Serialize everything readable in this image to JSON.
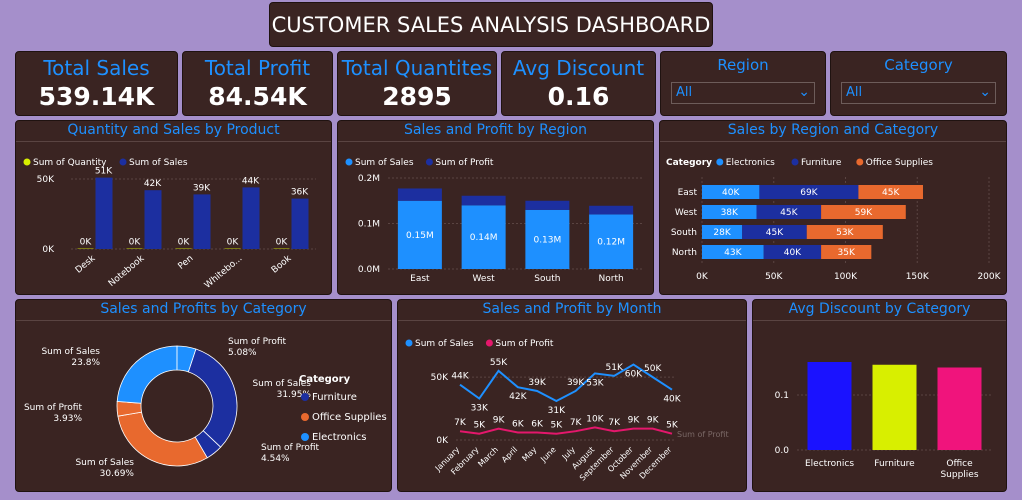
{
  "title": "CUSTOMER SALES ANALYSIS DASHBOARD",
  "kpis": [
    {
      "label": "Total Sales",
      "value": "539.14K"
    },
    {
      "label": "Total Profit",
      "value": "84.54K"
    },
    {
      "label": "Total Quantites",
      "value": "2895"
    },
    {
      "label": "Avg Discount",
      "value": "0.16"
    }
  ],
  "slicers": [
    {
      "label": "Region",
      "value": "All"
    },
    {
      "label": "Category",
      "value": "All"
    }
  ],
  "colors": {
    "blue": "#1e90ff",
    "navy": "#1c2fa0",
    "lime": "#d8ef00",
    "orange": "#e8692e",
    "pink": "#f0147c",
    "magenta": "#e4176c",
    "bg": "#3a2422"
  },
  "chart_data": [
    {
      "type": "bar",
      "title": "Quantity and Sales by Product",
      "categories": [
        "Desk",
        "Notebook",
        "Pen",
        "Whiteboard",
        "Book"
      ],
      "category_labels": [
        "Desk",
        "Notebook",
        "Pen",
        "Whitebo...",
        "Book"
      ],
      "series": [
        {
          "name": "Sum of Quantity",
          "values": [
            0.3,
            0.3,
            0.3,
            0.3,
            0.3
          ],
          "labels": [
            "0K",
            "0K",
            "0K",
            "0K",
            "0K"
          ]
        },
        {
          "name": "Sum of Sales",
          "values": [
            51,
            42,
            39,
            44,
            36
          ],
          "labels": [
            "51K",
            "42K",
            "39K",
            "44K",
            "36K"
          ]
        }
      ],
      "yticks": [
        "0K",
        "50K"
      ],
      "ylim": [
        0,
        60
      ]
    },
    {
      "type": "bar",
      "title": "Sales and Profit by Region",
      "categories": [
        "East",
        "West",
        "South",
        "North"
      ],
      "series": [
        {
          "name": "Sum of Sales",
          "values": [
            0.15,
            0.14,
            0.13,
            0.12
          ],
          "labels": [
            "0.15M",
            "0.14M",
            "0.13M",
            "0.12M"
          ]
        },
        {
          "name": "Sum of Profit",
          "values": [
            0.027,
            0.021,
            0.02,
            0.019
          ]
        }
      ],
      "stacked": true,
      "yticks": [
        "0.0M",
        "0.1M",
        "0.2M"
      ],
      "ylim": [
        0,
        0.2
      ]
    },
    {
      "type": "bar",
      "orientation": "horizontal",
      "title": "Sales by Region and Category",
      "legend_title": "Category",
      "categories": [
        "East",
        "West",
        "South",
        "North"
      ],
      "series": [
        {
          "name": "Electronics",
          "values": [
            40,
            38,
            28,
            43
          ],
          "labels": [
            "40K",
            "38K",
            "28K",
            "43K"
          ]
        },
        {
          "name": "Furniture",
          "values": [
            69,
            45,
            45,
            40
          ],
          "labels": [
            "69K",
            "45K",
            "45K",
            "40K"
          ]
        },
        {
          "name": "Office Supplies",
          "values": [
            45,
            59,
            53,
            35
          ],
          "labels": [
            "45K",
            "59K",
            "53K",
            "35K"
          ]
        }
      ],
      "stacked": true,
      "xticks": [
        "0K",
        "50K",
        "100K",
        "150K",
        "200K"
      ],
      "xlim": [
        0,
        200
      ]
    },
    {
      "type": "pie",
      "title": "Sales and Profits by Category",
      "legend_title": "Category",
      "legend": [
        "Furniture",
        "Office Supplies",
        "Electronics"
      ],
      "slices": [
        {
          "label": "Sum of Sales",
          "pct": "31.95%",
          "value": 31.95,
          "category": "Furniture"
        },
        {
          "label": "Sum of Profit",
          "pct": "4.54%",
          "value": 4.54,
          "category": "Furniture"
        },
        {
          "label": "Sum of Sales",
          "pct": "30.69%",
          "value": 30.69,
          "category": "Office Supplies"
        },
        {
          "label": "Sum of Profit",
          "pct": "3.93%",
          "value": 3.93,
          "category": "Office Supplies"
        },
        {
          "label": "Sum of Sales",
          "pct": "23.8%",
          "value": 23.8,
          "category": "Electronics"
        },
        {
          "label": "Sum of Profit",
          "pct": "5.08%",
          "value": 5.08,
          "category": "Electronics"
        }
      ]
    },
    {
      "type": "line",
      "title": "Sales and Profit by Month",
      "x": [
        "January",
        "February",
        "March",
        "April",
        "May",
        "June",
        "July",
        "August",
        "September",
        "October",
        "November",
        "December"
      ],
      "series": [
        {
          "name": "Sum of Sales",
          "values": [
            44,
            33,
            55,
            42,
            39,
            31,
            39,
            53,
            51,
            60,
            50,
            40
          ],
          "labels": [
            "44K",
            "33K",
            "55K",
            "42K",
            "39K",
            "31K",
            "39K",
            "53K",
            "51K",
            "60K",
            "50K",
            "40K"
          ]
        },
        {
          "name": "Sum of Profit",
          "values": [
            7,
            5,
            9,
            6,
            6,
            5,
            7,
            10,
            7,
            9,
            9,
            5
          ],
          "labels": [
            "7K",
            "5K",
            "9K",
            "6K",
            "6K",
            "5K",
            "7K",
            "10K",
            "7K",
            "9K",
            "9K",
            "5K"
          ]
        }
      ],
      "yticks": [
        "0K",
        "50K"
      ],
      "ylim": [
        0,
        70
      ],
      "annotation": "Sum of Profit"
    },
    {
      "type": "bar",
      "title": "Avg Discount by Category",
      "categories": [
        "Electronics",
        "Furniture",
        "Office Supplies"
      ],
      "values": [
        0.16,
        0.155,
        0.15
      ],
      "colors": [
        "#1a12ff",
        "#d8ef00",
        "#f0147c"
      ],
      "yticks": [
        "0.0",
        "0.1"
      ],
      "ylim": [
        0,
        0.2
      ]
    }
  ]
}
